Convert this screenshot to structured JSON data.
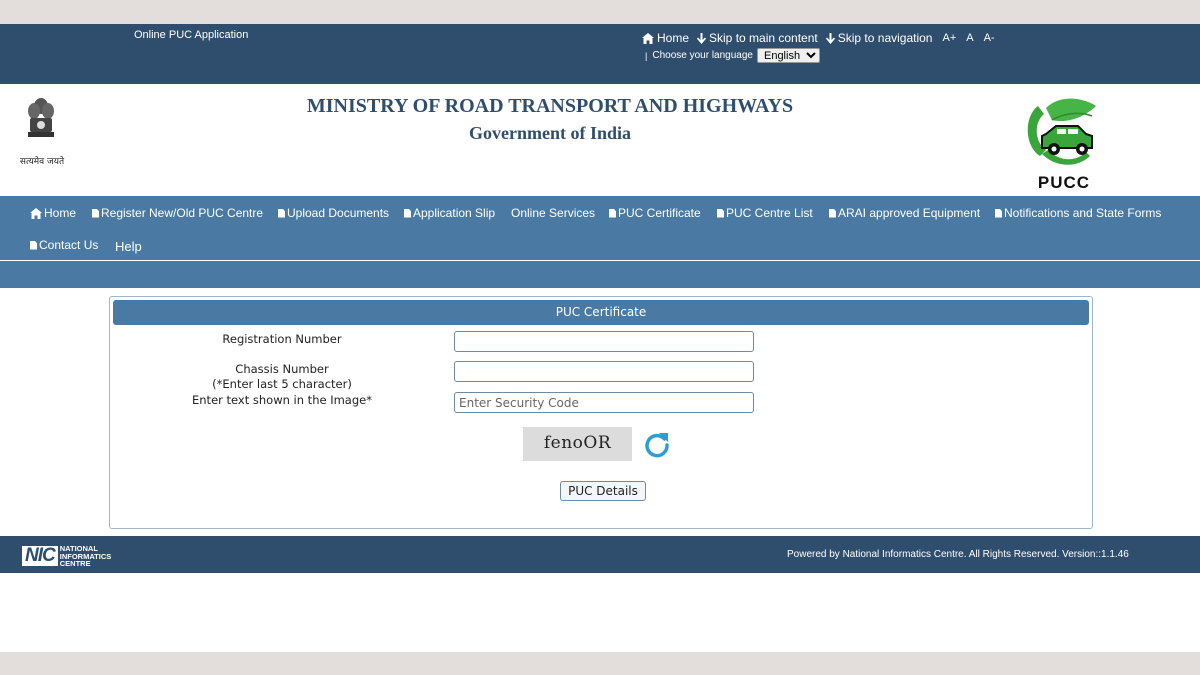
{
  "topbar": {
    "app_title": "Online PUC Application",
    "home": "Home",
    "skip_main": "Skip to main content",
    "skip_nav": "Skip to navigation",
    "font_increase": "A+",
    "font_normal": "A",
    "font_decrease": "A-",
    "language_label": "Choose your language",
    "language_value": "English"
  },
  "header": {
    "ministry": "MINISTRY OF ROAD TRANSPORT AND HIGHWAYS",
    "government": "Government of India",
    "emblem_caption": "सत्यमेव जयते",
    "logo_text": "PUCC"
  },
  "nav": {
    "items": [
      {
        "label": "Home"
      },
      {
        "label": "Register New/Old PUC Centre"
      },
      {
        "label": "Upload Documents"
      },
      {
        "label": "Application Slip"
      },
      {
        "label": "Online Services"
      },
      {
        "label": "PUC Certificate"
      },
      {
        "label": "PUC Centre List"
      },
      {
        "label": "ARAI approved Equipment"
      },
      {
        "label": "Notifications and State Forms"
      },
      {
        "label": "Contact Us"
      },
      {
        "label": "Help"
      }
    ]
  },
  "form": {
    "title": "PUC Certificate",
    "reg_label": "Registration Number",
    "reg_value": "",
    "chassis_label": "Chassis Number",
    "chassis_hint": "(*Enter last 5 character)",
    "chassis_value": "",
    "captcha_label": "Enter text shown in the Image*",
    "captcha_placeholder": "Enter Security Code",
    "captcha_text": "fenoOR",
    "submit_label": "PUC Details"
  },
  "footer": {
    "nic_abbr": "NIC",
    "nic_line1": "NATIONAL",
    "nic_line2": "INFORMATICS",
    "nic_line3": "CENTRE",
    "powered": "Powered by National Informatics Centre. All Rights Reserved. Version::1.1.46"
  },
  "colors": {
    "topbar": "#2f4e6e",
    "nav": "#4a7aa3",
    "pucc_green": "#3aa53a",
    "refresh_blue": "#2a9fd6"
  }
}
